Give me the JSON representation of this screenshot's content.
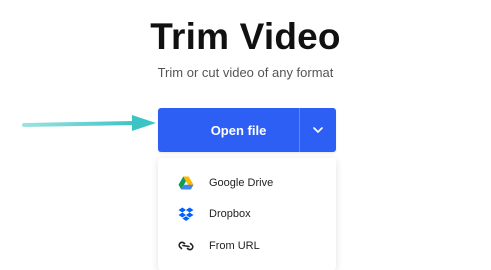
{
  "header": {
    "title": "Trim Video",
    "subtitle": "Trim or cut video of any format"
  },
  "open_button": {
    "label": "Open file",
    "dropdown_icon": "chevron-down-icon",
    "color": "#2d5ff5"
  },
  "dropdown": {
    "items": [
      {
        "label": "Google Drive",
        "icon": "google-drive-icon"
      },
      {
        "label": "Dropbox",
        "icon": "dropbox-icon"
      },
      {
        "label": "From URL",
        "icon": "link-icon"
      }
    ]
  },
  "annotation": {
    "arrow_color": "#3cc4c4",
    "icon": "pointer-arrow-icon"
  }
}
